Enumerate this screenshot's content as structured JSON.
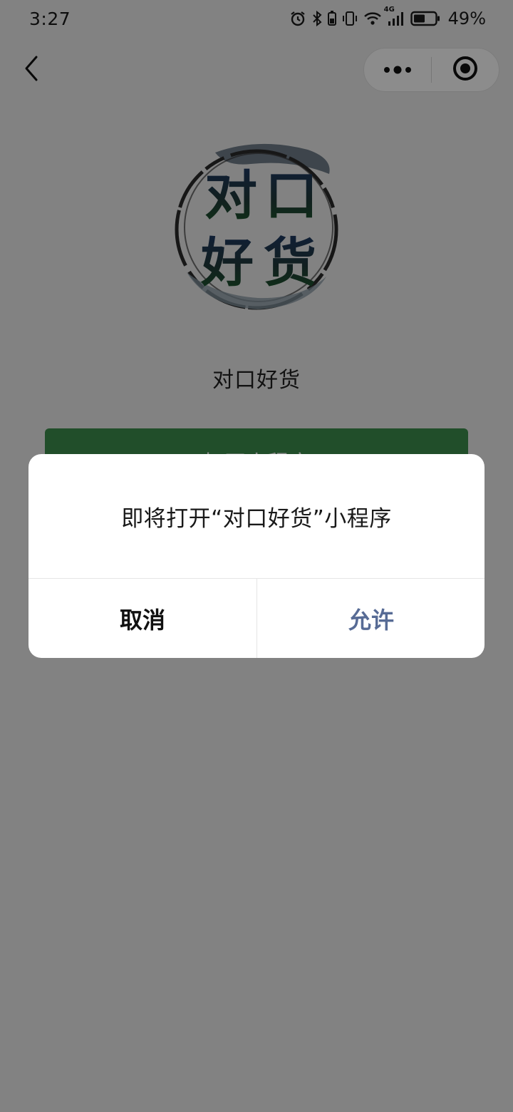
{
  "status_bar": {
    "time": "3:27",
    "battery_percent": "49%",
    "icons": [
      "alarm-icon",
      "bluetooth-icon",
      "vibrate-icon",
      "wifi-icon",
      "4g-icon",
      "signal-icon",
      "battery-icon"
    ],
    "network_label": "4G"
  },
  "nav": {
    "back_icon": "chevron-left-icon",
    "capsule": {
      "more_icon": "more-dots-icon",
      "close_icon": "target-close-icon"
    }
  },
  "app": {
    "logo_text": [
      "对",
      "口",
      "好",
      "货"
    ],
    "name": "对口好货",
    "open_button_label": "打开小程序",
    "brand_color": "#3d8f4d"
  },
  "dialog": {
    "message": "即将打开“对口好货”小程序",
    "cancel_label": "取消",
    "allow_label": "允许",
    "allow_color": "#576b95"
  }
}
